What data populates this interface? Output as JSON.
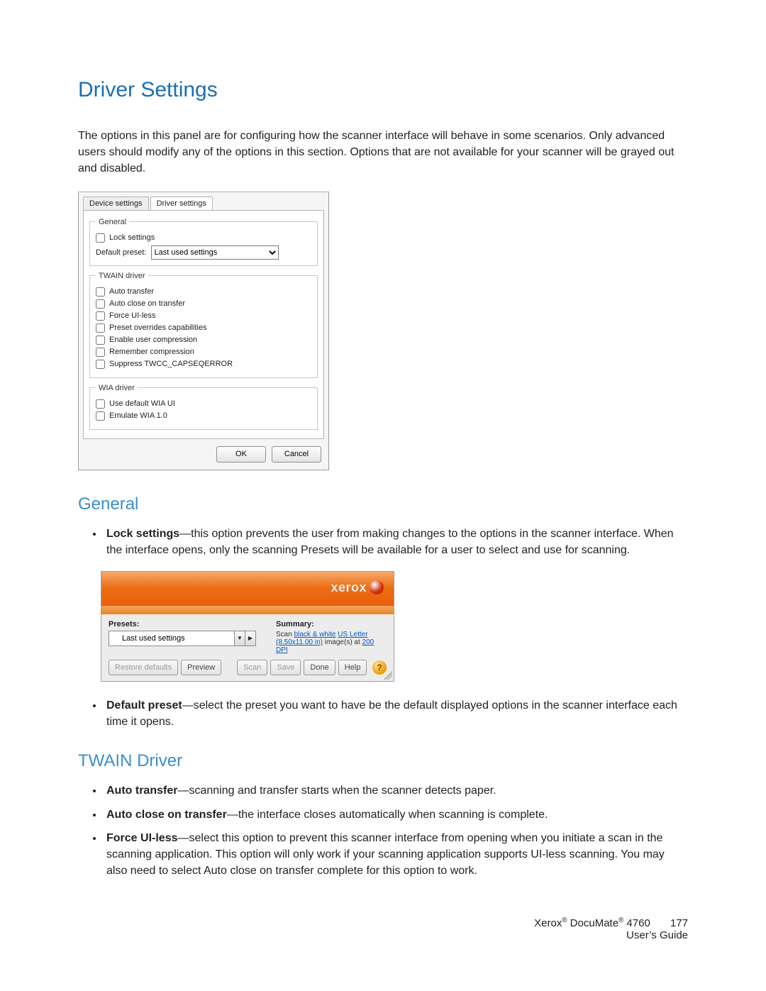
{
  "title": "Driver Settings",
  "intro": "The options in this panel are for configuring how the scanner interface will behave in some scenarios. Only advanced users should modify any of the options in this section. Options that are not available for your scanner will be grayed out and disabled.",
  "dialog": {
    "tabs": {
      "device": "Device settings",
      "driver": "Driver settings"
    },
    "general": {
      "legend": "General",
      "lock": "Lock settings",
      "defaultPresetLabel": "Default preset:",
      "defaultPresetValue": "Last used settings"
    },
    "twain": {
      "legend": "TWAIN driver",
      "auto": "Auto transfer",
      "autoClose": "Auto close on transfer",
      "force": "Force UI-less",
      "preset": "Preset overrides capabilities",
      "enableComp": "Enable user compression",
      "rememberComp": "Remember compression",
      "suppress": "Suppress TWCC_CAPSEQERROR"
    },
    "wia": {
      "legend": "WIA driver",
      "def": "Use default WIA UI",
      "emu": "Emulate WIA 1.0"
    },
    "buttons": {
      "ok": "OK",
      "cancel": "Cancel"
    }
  },
  "section_general": {
    "heading": "General",
    "lock_bold": "Lock settings",
    "lock_rest": "—this option prevents the user from making changes to the options in the scanner interface. When the interface opens, only the scanning Presets will be available for a user to select and use for scanning.",
    "default_bold": "Default preset",
    "default_rest": "—select the preset you want to have be the default displayed options in the scanner interface each time it opens."
  },
  "xerox": {
    "brand": "xerox",
    "presetsLabel": "Presets:",
    "presetValue": "Last used settings",
    "summaryLabel": "Summary:",
    "summary_a": "Scan ",
    "summary_link1": "black & white",
    "summary_b": " ",
    "summary_link2": "US Letter (8.50x11.00 in)",
    "summary_c": " image(s) at ",
    "summary_link3": "200 DPI",
    "btn_restore": "Restore defaults",
    "btn_preview": "Preview",
    "btn_scan": "Scan",
    "btn_save": "Save",
    "btn_done": "Done",
    "btn_help": "Help"
  },
  "section_twain": {
    "heading": "TWAIN Driver",
    "auto_bold": "Auto transfer",
    "auto_rest": "—scanning and transfer starts when the scanner detects paper.",
    "close_bold": "Auto close on transfer",
    "close_rest": "—the interface closes automatically when scanning is complete.",
    "force_bold": "Force UI-less",
    "force_rest": "—select this option to prevent this scanner interface from opening when you initiate a scan in the scanning application. This option will only work if your scanning application supports UI-less scanning. You may also need to select Auto close on transfer complete for this option to work."
  },
  "footer": {
    "product_a": "Xerox",
    "product_b": " DocuMate",
    "product_c": " 4760",
    "guide": "User’s Guide",
    "page": "177"
  }
}
